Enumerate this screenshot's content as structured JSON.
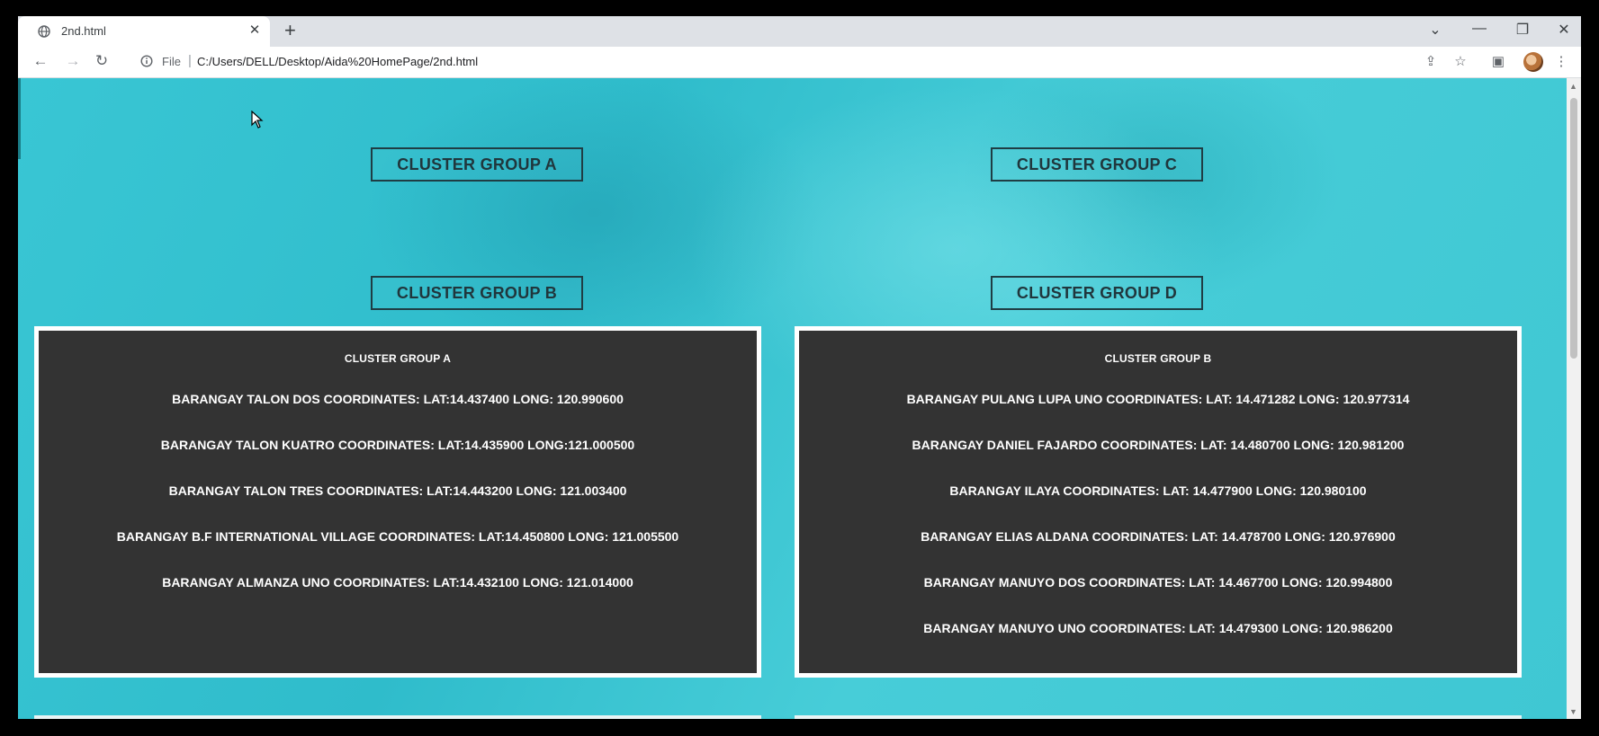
{
  "browser": {
    "tab_title": "2nd.html",
    "tab_close": "✕",
    "new_tab": "+",
    "window_controls": {
      "list": "⌄",
      "minimize": "—",
      "restore": "❐",
      "close": "✕"
    },
    "nav": {
      "back": "←",
      "forward": "→",
      "reload": "↻"
    },
    "address": {
      "scheme_label": "File",
      "separator": "|",
      "url": "C:/Users/DELL/Desktop/Aida%20HomePage/2nd.html"
    },
    "toolbar_icons": {
      "share": "⇪",
      "bookmark": "☆",
      "sidepanel": "▣",
      "menu": "⋮"
    }
  },
  "nav_buttons": {
    "a": "CLUSTER GROUP A",
    "b": "CLUSTER GROUP B",
    "c": "CLUSTER GROUP C",
    "d": "CLUSTER GROUP D"
  },
  "panels": [
    {
      "title": "CLUSTER GROUP A",
      "entries": [
        "BARANGAY TALON DOS COORDINATES: LAT:14.437400 LONG: 120.990600",
        "BARANGAY TALON KUATRO COORDINATES: LAT:14.435900 LONG:121.000500",
        "BARANGAY TALON TRES COORDINATES: LAT:14.443200 LONG: 121.003400",
        "BARANGAY B.F INTERNATIONAL VILLAGE COORDINATES: LAT:14.450800 LONG: 121.005500",
        "BARANGAY ALMANZA UNO COORDINATES: LAT:14.432100 LONG: 121.014000"
      ]
    },
    {
      "title": "CLUSTER GROUP B",
      "entries": [
        "BARANGAY PULANG LUPA UNO COORDINATES: LAT: 14.471282 LONG: 120.977314",
        "BARANGAY DANIEL FAJARDO COORDINATES: LAT: 14.480700 LONG: 120.981200",
        "BARANGAY ILAYA COORDINATES: LAT: 14.477900 LONG: 120.980100",
        "BARANGAY ELIAS ALDANA COORDINATES: LAT: 14.478700 LONG: 120.976900",
        "BARANGAY MANUYO DOS COORDINATES: LAT: 14.467700 LONG: 120.994800",
        "BARANGAY MANUYO UNO COORDINATES: LAT: 14.479300 LONG: 120.986200"
      ]
    }
  ]
}
